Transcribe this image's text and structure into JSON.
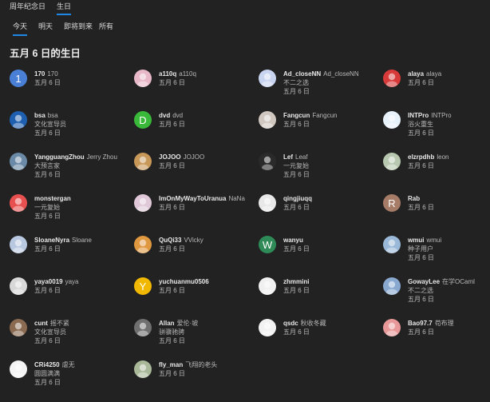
{
  "top_tabs": [
    {
      "label": "周年纪念日",
      "active": false
    },
    {
      "label": "生日",
      "active": true
    }
  ],
  "sub_tabs": [
    {
      "label": "今天",
      "active": true
    },
    {
      "label": "明天",
      "active": false
    },
    {
      "label": "即将到来",
      "active": false
    },
    {
      "label": "所有",
      "active": false
    }
  ],
  "title": "五月 6 日的生日",
  "users": [
    {
      "username": "170",
      "display": "170",
      "title": "",
      "date": "五月 6 日",
      "avatar": {
        "type": "letter",
        "letter": "1",
        "color": "#4a7fd6"
      }
    },
    {
      "username": "a110q",
      "display": "a110q",
      "title": "",
      "date": "五月 6 日",
      "avatar": {
        "type": "image",
        "icon": "anime-pink-avatar-icon",
        "color": "#e8b8c8"
      }
    },
    {
      "username": "Ad_closeNN",
      "display": "Ad_closeNN",
      "title": "不二之选",
      "date": "五月 6 日",
      "avatar": {
        "type": "image",
        "icon": "anime-blue-avatar-icon",
        "color": "#c8d4f0"
      }
    },
    {
      "username": "alaya",
      "display": "alaya",
      "title": "",
      "date": "五月 6 日",
      "avatar": {
        "type": "image",
        "icon": "red-figure-avatar-icon",
        "color": "#d83a3a"
      }
    },
    {
      "username": "bsa",
      "display": "bsa",
      "title": "文化宣导员",
      "date": "五月 6 日",
      "avatar": {
        "type": "image",
        "icon": "flag-avatar-icon",
        "color": "#1f5fb0"
      }
    },
    {
      "username": "dvd",
      "display": "dvd",
      "title": "",
      "date": "五月 6 日",
      "avatar": {
        "type": "letter",
        "letter": "D",
        "color": "#3ab83a"
      }
    },
    {
      "username": "Fangcun",
      "display": "Fangcun",
      "title": "",
      "date": "五月 6 日",
      "avatar": {
        "type": "image",
        "icon": "portrait-avatar-icon",
        "color": "#d0c8c0"
      }
    },
    {
      "username": "INTPro",
      "display": "INTPro",
      "title": "浴火重生",
      "date": "五月 6 日",
      "avatar": {
        "type": "image",
        "icon": "infinity-avatar-icon",
        "color": "#e8f2fa"
      }
    },
    {
      "username": "YangguangZhou",
      "display": "Jerry Zhou",
      "title": "大预言家",
      "date": "五月 6 日",
      "avatar": {
        "type": "image",
        "icon": "landscape-avatar-icon",
        "color": "#6a8aa8"
      }
    },
    {
      "username": "JOJOO",
      "display": "JOJOO",
      "title": "",
      "date": "五月 6 日",
      "avatar": {
        "type": "image",
        "icon": "dog-avatar-icon",
        "color": "#c89858"
      }
    },
    {
      "username": "Lef",
      "display": "Leaf",
      "title": "一元复始",
      "date": "五月 6 日",
      "avatar": {
        "type": "image",
        "icon": "dark-avatar-icon",
        "color": "#2a2a2a"
      }
    },
    {
      "username": "elzrpdhb",
      "display": "leon",
      "title": "",
      "date": "五月 6 日",
      "avatar": {
        "type": "image",
        "icon": "cartoon-avatar-icon",
        "color": "#b8c8b0"
      }
    },
    {
      "username": "monstergan",
      "display": "",
      "title": "一元复始",
      "date": "五月 6 日",
      "avatar": {
        "type": "image",
        "icon": "crayon-avatar-icon",
        "color": "#e85050"
      }
    },
    {
      "username": "ImOnMyWayToUranua",
      "display": "NaNa",
      "title": "",
      "date": "五月 6 日",
      "avatar": {
        "type": "image",
        "icon": "anime-light-avatar-icon",
        "color": "#e0c8d8"
      }
    },
    {
      "username": "qingjiuqq",
      "display": "",
      "title": "",
      "date": "五月 6 日",
      "avatar": {
        "type": "image",
        "icon": "anime-white-avatar-icon",
        "color": "#e8e8e8"
      }
    },
    {
      "username": "Rab",
      "display": "",
      "title": "",
      "date": "五月 6 日",
      "avatar": {
        "type": "letter",
        "letter": "R",
        "color": "#a67c68"
      }
    },
    {
      "username": "SloaneNyra",
      "display": "Sloane",
      "title": "",
      "date": "五月 6 日",
      "avatar": {
        "type": "image",
        "icon": "anime-dark-avatar-icon",
        "color": "#b8c8e0"
      }
    },
    {
      "username": "QuQi33",
      "display": "VVicky",
      "title": "",
      "date": "五月 6 日",
      "avatar": {
        "type": "image",
        "icon": "shiba-avatar-icon",
        "color": "#e09840"
      }
    },
    {
      "username": "wanyu",
      "display": "",
      "title": "",
      "date": "五月 6 日",
      "avatar": {
        "type": "letter",
        "letter": "W",
        "color": "#2e8b57"
      }
    },
    {
      "username": "wmui",
      "display": "wmui",
      "title": "种子用户",
      "date": "五月 6 日",
      "avatar": {
        "type": "image",
        "icon": "robot-avatar-icon",
        "color": "#9ab8d8"
      }
    },
    {
      "username": "yaya0019",
      "display": "yaya",
      "title": "",
      "date": "五月 6 日",
      "avatar": {
        "type": "image",
        "icon": "anime-grey-avatar-icon",
        "color": "#d8d8d8"
      }
    },
    {
      "username": "yuchuanmu0506",
      "display": "",
      "title": "",
      "date": "五月 6 日",
      "avatar": {
        "type": "letter",
        "letter": "Y",
        "color": "#f0b800"
      }
    },
    {
      "username": "zhmmini",
      "display": "",
      "title": "",
      "date": "五月 6 日",
      "avatar": {
        "type": "image",
        "icon": "sketch-avatar-icon",
        "color": "#f0f0f0"
      }
    },
    {
      "username": "GowayLee",
      "display": "在学OCaml",
      "title": "不二之选",
      "date": "五月 6 日",
      "avatar": {
        "type": "image",
        "icon": "blue-pattern-avatar-icon",
        "color": "#88a8d0"
      }
    },
    {
      "username": "cunt",
      "display": "摇不紧",
      "title": "文化宣导员",
      "date": "五月 6 日",
      "avatar": {
        "type": "image",
        "icon": "person-avatar-icon",
        "color": "#8a6a50"
      }
    },
    {
      "username": "Allan",
      "display": "爱伦·坡",
      "title": "骈骥驰骋",
      "date": "五月 6 日",
      "avatar": {
        "type": "image",
        "icon": "gentleman-avatar-icon",
        "color": "#707070"
      }
    },
    {
      "username": "qsdc",
      "display": "秋收冬藏",
      "title": "",
      "date": "五月 6 日",
      "avatar": {
        "type": "image",
        "icon": "panda-avatar-icon",
        "color": "#f2f2f2"
      }
    },
    {
      "username": "Bao97.7",
      "display": "苟布理",
      "title": "",
      "date": "五月 6 日",
      "avatar": {
        "type": "image",
        "icon": "pink-cartoon-avatar-icon",
        "color": "#e89898"
      }
    },
    {
      "username": "CRi4250",
      "display": "虐无",
      "title": "圆圆满满",
      "date": "五月 6 日",
      "avatar": {
        "type": "image",
        "icon": "geometric-avatar-icon",
        "color": "#f4f4f4"
      }
    },
    {
      "username": "fly_man",
      "display": "飞翔的老头",
      "title": "",
      "date": "五月 6 日",
      "avatar": {
        "type": "image",
        "icon": "cat-avatar-icon",
        "color": "#a8b898"
      }
    }
  ]
}
